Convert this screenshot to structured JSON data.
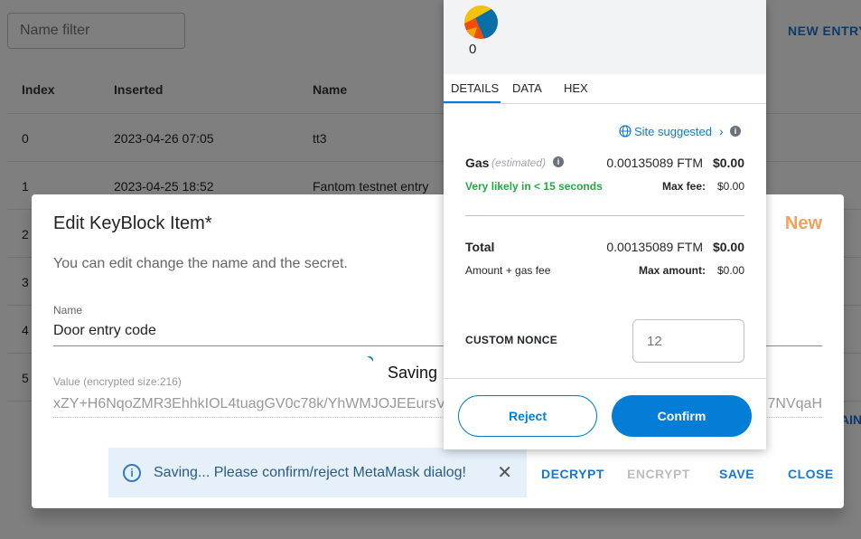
{
  "app": {
    "name_filter_placeholder": "Name filter",
    "new_entry_label": "NEW ENTRY",
    "table": {
      "columns": [
        "Index",
        "Inserted",
        "Name"
      ],
      "rows": [
        {
          "index": "0",
          "inserted": "2023-04-26 07:05",
          "name": "tt3"
        },
        {
          "index": "1",
          "inserted": "2023-04-25 18:52",
          "name": "Fantom testnet entry"
        },
        {
          "index": "2"
        },
        {
          "index": "3"
        },
        {
          "index": "4"
        },
        {
          "index": "5"
        }
      ]
    },
    "bg_tail_text": "AIN"
  },
  "dialog": {
    "title": "Edit KeyBlock Item*",
    "badge": "New",
    "description": "You can edit change the name and the secret.",
    "name_label": "Name",
    "name_value": "Door entry code",
    "value_label": "Value (encrypted size:216)",
    "value_text": "xZY+H6NqoZMR3EhhkIOL4tuagGV0c78k/YhWMJOJEEursV",
    "value_tail": "7NVqaH",
    "saving_text": "Saving",
    "alert_text": "Saving... Please confirm/reject MetaMask dialog!",
    "actions": {
      "decrypt": "DECRYPT",
      "encrypt": "ENCRYPT",
      "save": "SAVE",
      "close": "CLOSE"
    }
  },
  "metamask": {
    "account_count": "0",
    "tabs": [
      "DETAILS",
      "DATA",
      "HEX"
    ],
    "active_tab": "DETAILS",
    "site_suggested": "Site suggested",
    "gas_label": "Gas",
    "gas_estimated": "(estimated)",
    "gas_ftm": "0.00135089 FTM",
    "gas_usd": "$0.00",
    "likely_text": "Very likely in < 15 seconds",
    "max_fee_label": "Max fee:",
    "max_fee_value": "$0.00",
    "total_label": "Total",
    "total_ftm": "0.00135089 FTM",
    "total_usd": "$0.00",
    "amount_gas_label": "Amount + gas fee",
    "max_amount_label": "Max amount:",
    "max_amount_value": "$0.00",
    "custom_nonce_label": "CUSTOM NONCE",
    "nonce_placeholder": "12",
    "reject_label": "Reject",
    "confirm_label": "Confirm"
  },
  "colors": {
    "primary": "#1976d2",
    "metamask_blue": "#037dd6",
    "success": "#28a745",
    "new_badge": "#f5a05a"
  }
}
